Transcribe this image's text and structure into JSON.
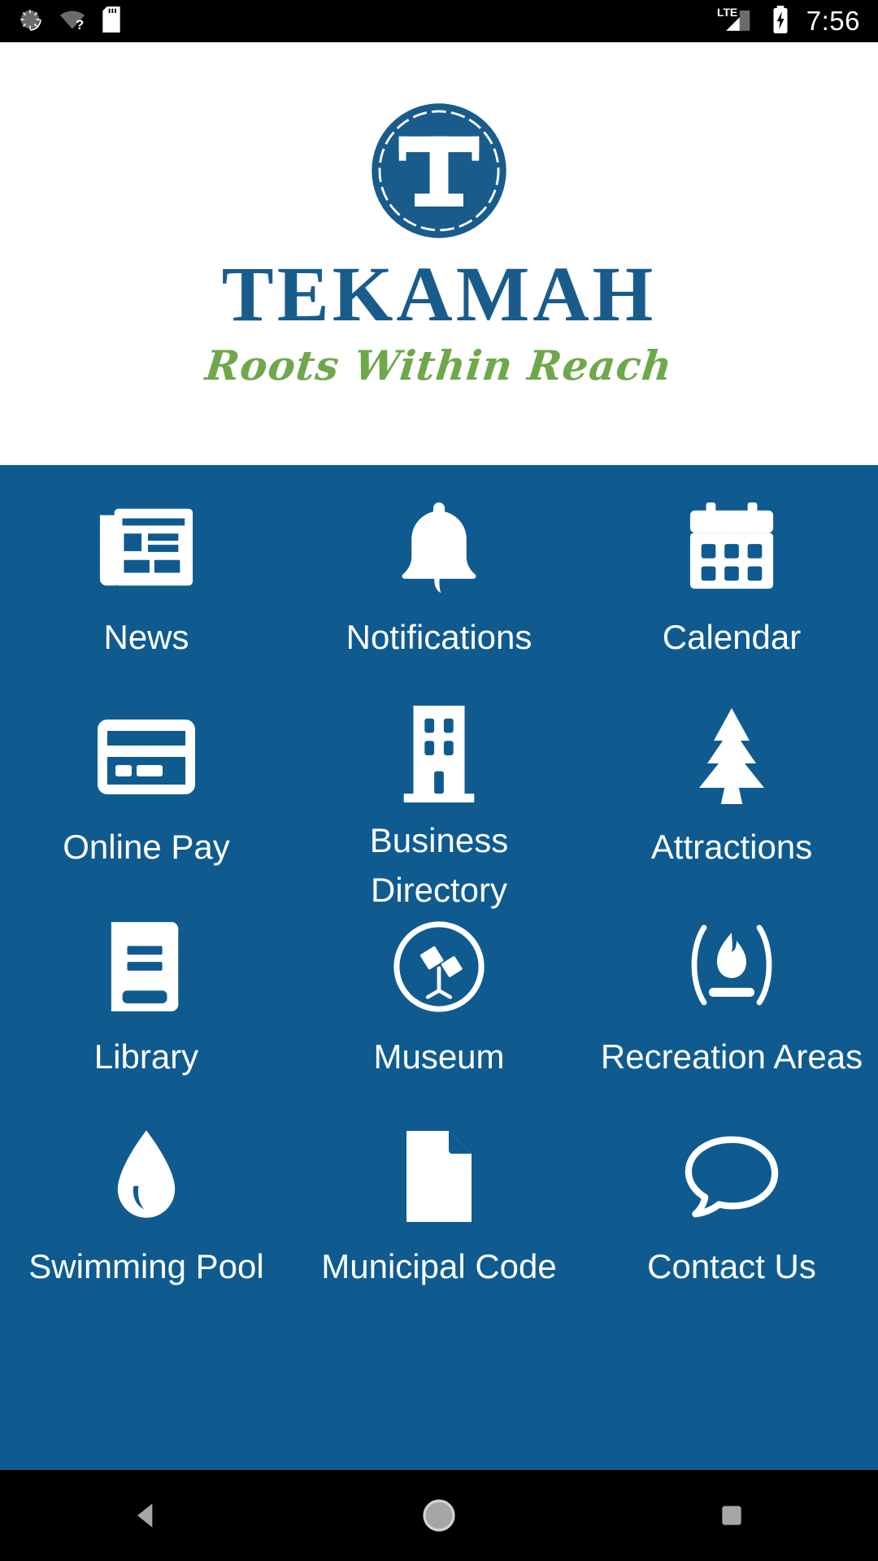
{
  "status_bar": {
    "time": "7:56",
    "left_icons": [
      {
        "name": "sync-spinner-icon"
      },
      {
        "name": "wifi-unknown-icon"
      },
      {
        "name": "sd-card-icon"
      }
    ],
    "right_icons": [
      {
        "name": "lte-signal-icon",
        "label": "LTE"
      },
      {
        "name": "battery-charging-icon"
      }
    ]
  },
  "logo": {
    "monogram": "T",
    "wordmark": "TEKAMAH",
    "tagline": "Roots Within Reach",
    "brand_blue": "#195C8C",
    "brand_green": "#6FA84C"
  },
  "theme": {
    "tile_background": "#0F5B8F",
    "tile_foreground": "#FFFFFF",
    "status_bar_background": "#000000"
  },
  "tiles": [
    {
      "label": "News",
      "icon": "newspaper-icon"
    },
    {
      "label": "Notifications",
      "icon": "bell-icon"
    },
    {
      "label": "Calendar",
      "icon": "calendar-icon"
    },
    {
      "label": "Online Pay",
      "icon": "credit-card-icon"
    },
    {
      "label": "Business Directory",
      "icon": "office-building-icon"
    },
    {
      "label": "Attractions",
      "icon": "pine-tree-icon"
    },
    {
      "label": "Library",
      "icon": "book-icon"
    },
    {
      "label": "Museum",
      "icon": "telescope-circle-icon"
    },
    {
      "label": "Recreation Areas",
      "icon": "campfire-icon"
    },
    {
      "label": "Swimming Pool",
      "icon": "water-drop-icon"
    },
    {
      "label": "Municipal Code",
      "icon": "document-icon"
    },
    {
      "label": "Contact Us",
      "icon": "speech-bubble-icon"
    }
  ],
  "nav_bar": {
    "buttons": [
      {
        "name": "back-button"
      },
      {
        "name": "home-button"
      },
      {
        "name": "recents-button"
      }
    ]
  }
}
